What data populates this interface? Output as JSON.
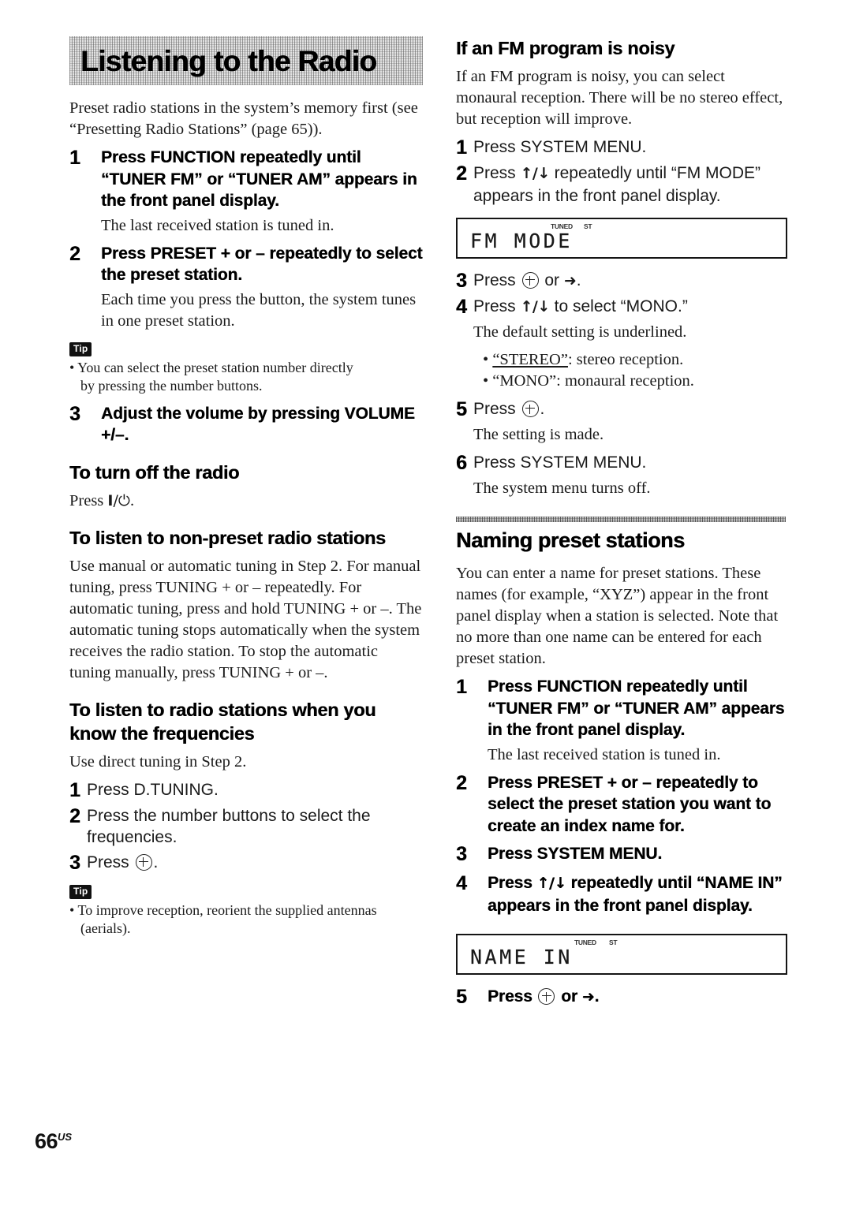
{
  "page": {
    "number": "66",
    "region_suffix": "US"
  },
  "left_column": {
    "banner_title": "Listening to the Radio",
    "intro": "Preset radio stations in the system’s memory first (see “Presetting Radio Stations” (page 65)).",
    "steps": [
      {
        "num": "1",
        "text": "Press FUNCTION repeatedly until “TUNER FM” or “TUNER AM” appears in the front panel display.",
        "note": "The last received station is tuned in."
      },
      {
        "num": "2",
        "text": "Press PRESET + or – repeatedly to select the preset station.",
        "note": "Each time you press the button, the system tunes in one preset station."
      },
      {
        "num": "3",
        "text": "Adjust the volume by pressing VOLUME +/–."
      }
    ],
    "tip1": {
      "badge": "Tip",
      "line1": "• You can select the preset station number directly",
      "line2": "by pressing the number buttons."
    },
    "heading_turn_off": "To turn off the radio",
    "turn_off_text_prefix": "Press ",
    "turn_off_text_suffix": ".",
    "heading_non_preset": "To listen to non-preset radio stations",
    "non_preset_body": "Use manual or automatic tuning in Step 2. For manual tuning, press TUNING + or – repeatedly. For automatic tuning, press and hold TUNING + or –. The automatic tuning stops automatically when the system receives the radio station. To stop the automatic tuning manually, press TUNING + or –.",
    "heading_frequencies": "To listen to radio stations when you know the frequencies",
    "frequencies_body": "Use direct tuning in Step 2.",
    "frequency_steps": [
      {
        "num": "1",
        "text": "Press D.TUNING."
      },
      {
        "num": "2",
        "text": "Press the number buttons to select the frequencies."
      },
      {
        "num": "3",
        "prefix": "Press ",
        "suffix": "."
      }
    ],
    "tip2": {
      "badge": "Tip",
      "line1": "• To improve reception, reorient the supplied antennas",
      "line2": "(aerials)."
    }
  },
  "right_column": {
    "heading_fm_noisy": "If an FM program is noisy",
    "fm_noisy_body": "If an FM program is noisy, you can select monaural reception. There will be no stereo effect, but reception will improve.",
    "fm_steps": {
      "s1": {
        "num": "1",
        "text": "Press SYSTEM MENU."
      },
      "s2": {
        "num": "2",
        "text_a": "Press ",
        "arrows": "↑/↓",
        "text_b": " repeatedly until “FM MODE” appears in the front panel display."
      },
      "s3": {
        "num": "3",
        "prefix": "Press ",
        "middle": " or ",
        "arrow": "➜",
        "suffix": "."
      },
      "s4": {
        "num": "4",
        "text_a": "Press ",
        "arrows": "↑/↓",
        "text_b": " to select “MONO.”",
        "note": "The default setting is underlined.",
        "bullet1_pre": "• ",
        "bullet1_ul": "“STEREO”",
        "bullet1_post": ": stereo reception.",
        "bullet2": "• “MONO”: monaural reception."
      },
      "s5": {
        "num": "5",
        "prefix": "Press ",
        "suffix": ".",
        "note": "The setting is made."
      },
      "s6": {
        "num": "6",
        "text": "Press SYSTEM MENU.",
        "note": "The system menu turns off."
      }
    },
    "lcd_fm_mode": {
      "segments": "FM MODE",
      "indicator_tuned": "TUNED",
      "indicator_st": "ST"
    },
    "section_naming": "Naming preset stations",
    "naming_body": "You can enter a name for preset stations. These names (for example, “XYZ”) appear in the front panel display when a station is selected. Note that no more than one name can be entered for each preset station.",
    "naming_steps": [
      {
        "num": "1",
        "text": "Press FUNCTION repeatedly until “TUNER FM” or “TUNER AM” appears in the front panel display.",
        "note": "The last received station is tuned in."
      },
      {
        "num": "2",
        "text": "Press PRESET + or – repeatedly to select the preset station you want to create an index name for."
      },
      {
        "num": "3",
        "text": "Press SYSTEM MENU."
      }
    ],
    "naming_step4": {
      "num": "4",
      "text_a": "Press ",
      "arrows": "↑/↓",
      "text_b": " repeatedly until “NAME IN” appears in the front panel display."
    },
    "lcd_name_in": {
      "segments": "NAME  IN",
      "indicator_tuned": "TUNED",
      "indicator_st": "ST"
    },
    "naming_step5": {
      "num": "5",
      "prefix": "Press ",
      "middle": " or ",
      "arrow": "➜",
      "suffix": "."
    }
  }
}
